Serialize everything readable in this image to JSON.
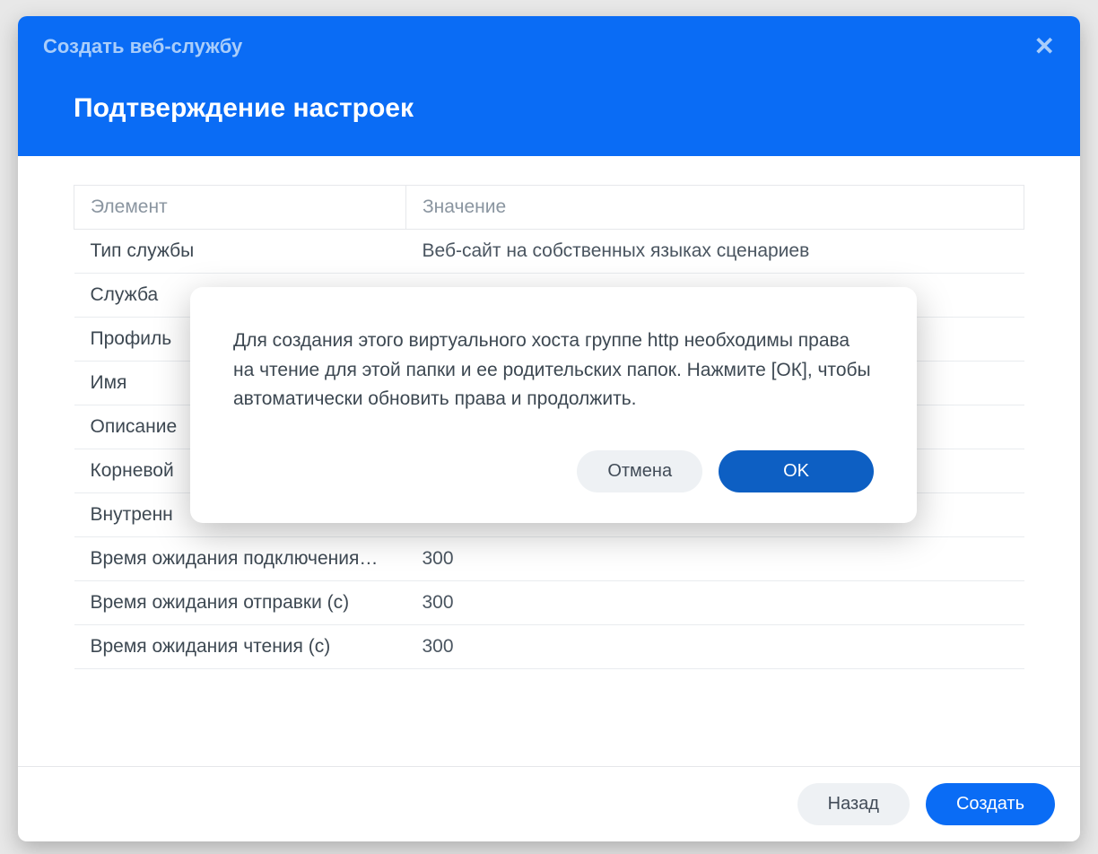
{
  "wizard": {
    "title": "Создать веб-службу",
    "subtitle": "Подтверждение настроек",
    "columns": {
      "item": "Элемент",
      "value": "Значение"
    },
    "rows": [
      {
        "k": "Тип службы",
        "v": "Веб-сайт на собственных языках сценариев"
      },
      {
        "k": "Служба",
        "v": ""
      },
      {
        "k": "Профиль",
        "v": ""
      },
      {
        "k": "Имя",
        "v": ""
      },
      {
        "k": "Описание",
        "v": ""
      },
      {
        "k": "Корневой",
        "v": ""
      },
      {
        "k": "Внутренн",
        "v": ""
      },
      {
        "k": "Время ожидания подключения…",
        "v": "300"
      },
      {
        "k": "Время ожидания отправки (с)",
        "v": "300"
      },
      {
        "k": "Время ожидания чтения (с)",
        "v": "300"
      }
    ],
    "footer": {
      "back": "Назад",
      "create": "Создать"
    }
  },
  "confirm": {
    "message": "Для создания этого виртуального хоста группе http необходимы права на чтение для этой папки и ее родительских папок. Нажмите [ОК], чтобы автоматически обновить права и продолжить.",
    "cancel": "Отмена",
    "ok": "OK"
  }
}
